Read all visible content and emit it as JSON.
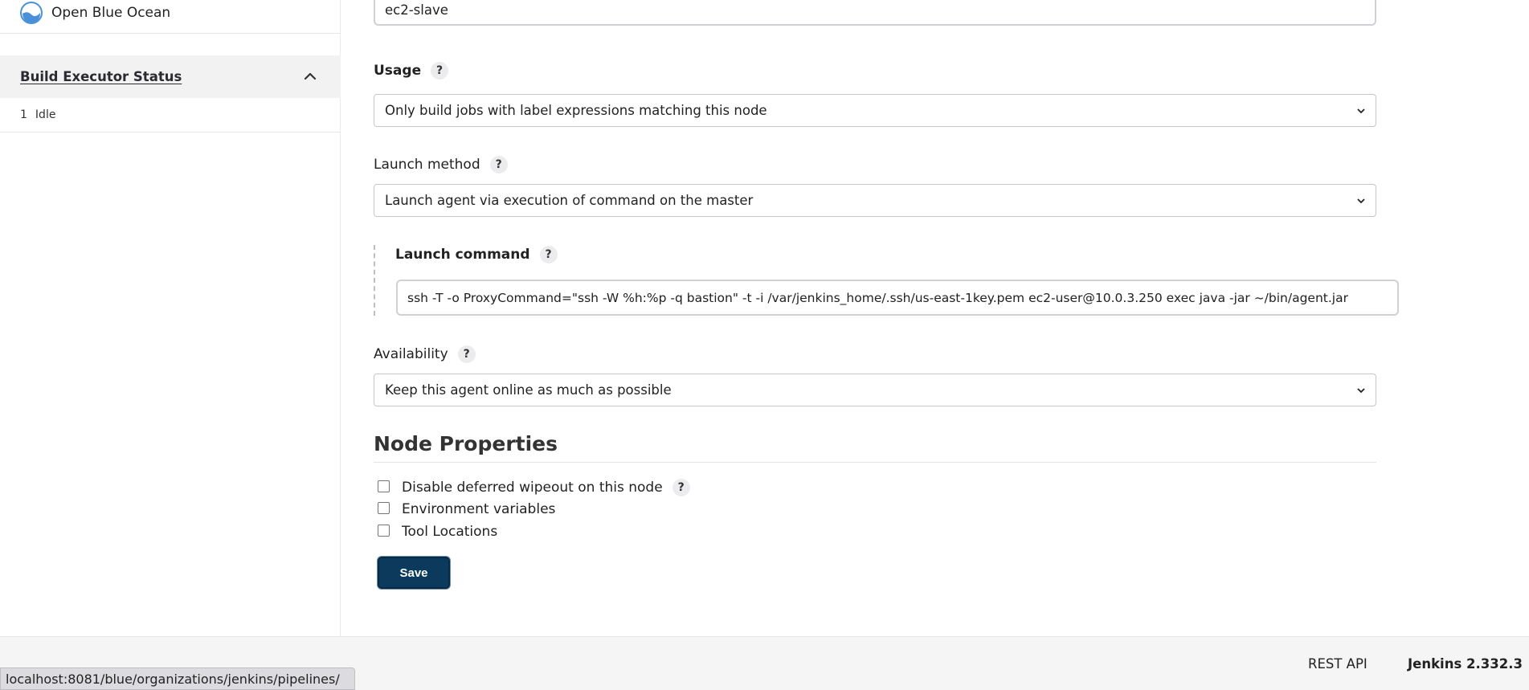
{
  "sidebar": {
    "blue_ocean_label": "Open Blue Ocean",
    "executor_status": {
      "title": "Build Executor Status",
      "rows": [
        {
          "number": "1",
          "state": "Idle"
        }
      ]
    }
  },
  "form": {
    "name_value": "ec2-slave",
    "usage": {
      "label": "Usage",
      "help": "?",
      "selected": "Only build jobs with label expressions matching this node"
    },
    "launch_method": {
      "label": "Launch method",
      "help": "?",
      "selected": "Launch agent via execution of command on the master"
    },
    "launch_command": {
      "label": "Launch command",
      "help": "?",
      "value": "ssh -T -o ProxyCommand=\"ssh -W %h:%p -q bastion\" -t  -i /var/jenkins_home/.ssh/us-east-1key.pem ec2-user@10.0.3.250 exec  java -jar ~/bin/agent.jar"
    },
    "availability": {
      "label": "Availability",
      "help": "?",
      "selected": "Keep this agent online as much as possible"
    },
    "node_properties": {
      "title": "Node Properties",
      "items": [
        {
          "label": "Disable deferred wipeout on this node",
          "checked": false,
          "help": "?"
        },
        {
          "label": "Environment variables",
          "checked": false
        },
        {
          "label": "Tool Locations",
          "checked": false
        }
      ]
    },
    "save_label": "Save"
  },
  "footer": {
    "rest_api": "REST API",
    "version": "Jenkins 2.332.3"
  },
  "status_bar_url": "localhost:8081/blue/organizations/jenkins/pipelines/",
  "colors": {
    "save_button": "#0b3a5c",
    "blue_ocean_icon": "#4a90d9"
  }
}
